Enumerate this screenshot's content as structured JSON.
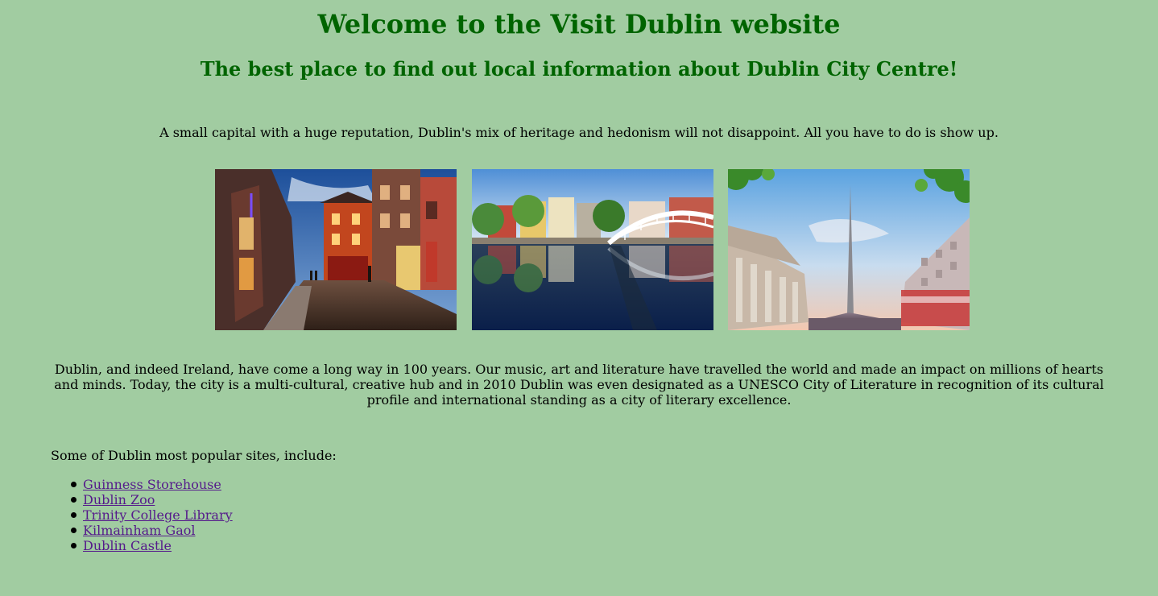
{
  "header": {
    "title": "Welcome to the Visit Dublin website",
    "subtitle": "The best place to find out local information about Dublin City Centre!"
  },
  "intro": "A small capital with a huge reputation, Dublin's mix of heritage and hedonism will not disappoint. All you have to do is show up.",
  "gallery": [
    {
      "subject": "temple-bar-street-at-dusk"
    },
    {
      "subject": "ha-penny-bridge-over-river-liffey"
    },
    {
      "subject": "spire-and-gpo-on-oconnell-street"
    }
  ],
  "description": "Dublin, and indeed Ireland, have come a long way in 100 years. Our music, art and literature have travelled the world and made an impact on millions of hearts and minds. Today, the city is a multi-cultural, creative hub and in 2010 Dublin was even designated as a UNESCO City of Literature in recognition of its cultural profile and international standing as a city of literary excellence.",
  "sites": {
    "intro": "Some of Dublin most popular sites, include:",
    "items": [
      {
        "label": "Guinness Storehouse"
      },
      {
        "label": "Dublin Zoo"
      },
      {
        "label": "Trinity College Library"
      },
      {
        "label": "Kilmainham Gaol"
      },
      {
        "label": "Dublin Castle"
      }
    ]
  },
  "colors": {
    "background": "#a1cca1",
    "heading": "#006400",
    "link": "#551a8b"
  }
}
